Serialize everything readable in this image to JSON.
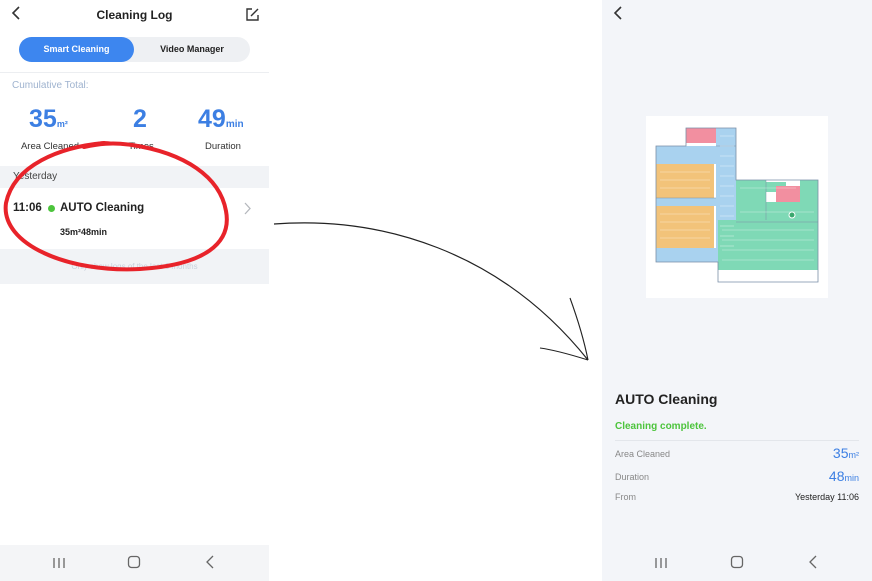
{
  "left": {
    "header": {
      "title": "Cleaning Log"
    },
    "tabs": [
      {
        "label": "Smart Cleaning",
        "active": true
      },
      {
        "label": "Video Manager",
        "active": false
      }
    ],
    "cumulative": {
      "label": "Cumulative Total:",
      "stats": [
        {
          "value": "35",
          "unit": "m²",
          "label": "Area Cleaned"
        },
        {
          "value": "2",
          "unit": "",
          "label": "Times"
        },
        {
          "value": "49",
          "unit": "min",
          "label": "Duration"
        }
      ]
    },
    "section": {
      "label": "Yesterday"
    },
    "entry": {
      "time": "11:06",
      "title": "AUTO Cleaning",
      "area": "35m²",
      "duration": "48min",
      "status_color": "#4cc43c"
    },
    "notice": "Only show logs of the last 6 months"
  },
  "right": {
    "result": {
      "title": "AUTO Cleaning",
      "status": "Cleaning complete.",
      "rows": [
        {
          "label": "Area Cleaned",
          "value": "35",
          "unit": "m²"
        },
        {
          "label": "Duration",
          "value": "48",
          "unit": "min"
        },
        {
          "label": "From",
          "value": "Yesterday 11:06"
        }
      ]
    }
  },
  "icons": {
    "back": "back-chevron-icon",
    "edit": "edit-icon",
    "nav": [
      "recent-apps-icon",
      "home-icon",
      "nav-back-icon"
    ]
  },
  "colors": {
    "accent": "#3d86ef",
    "stat": "#3c7fe3",
    "success": "#4cc43c",
    "annotation": "#e8232a",
    "room_blue": "#a9d2ef",
    "room_orange": "#f2c37a",
    "room_green": "#7fd9b6",
    "room_pink": "#f28fa0"
  }
}
